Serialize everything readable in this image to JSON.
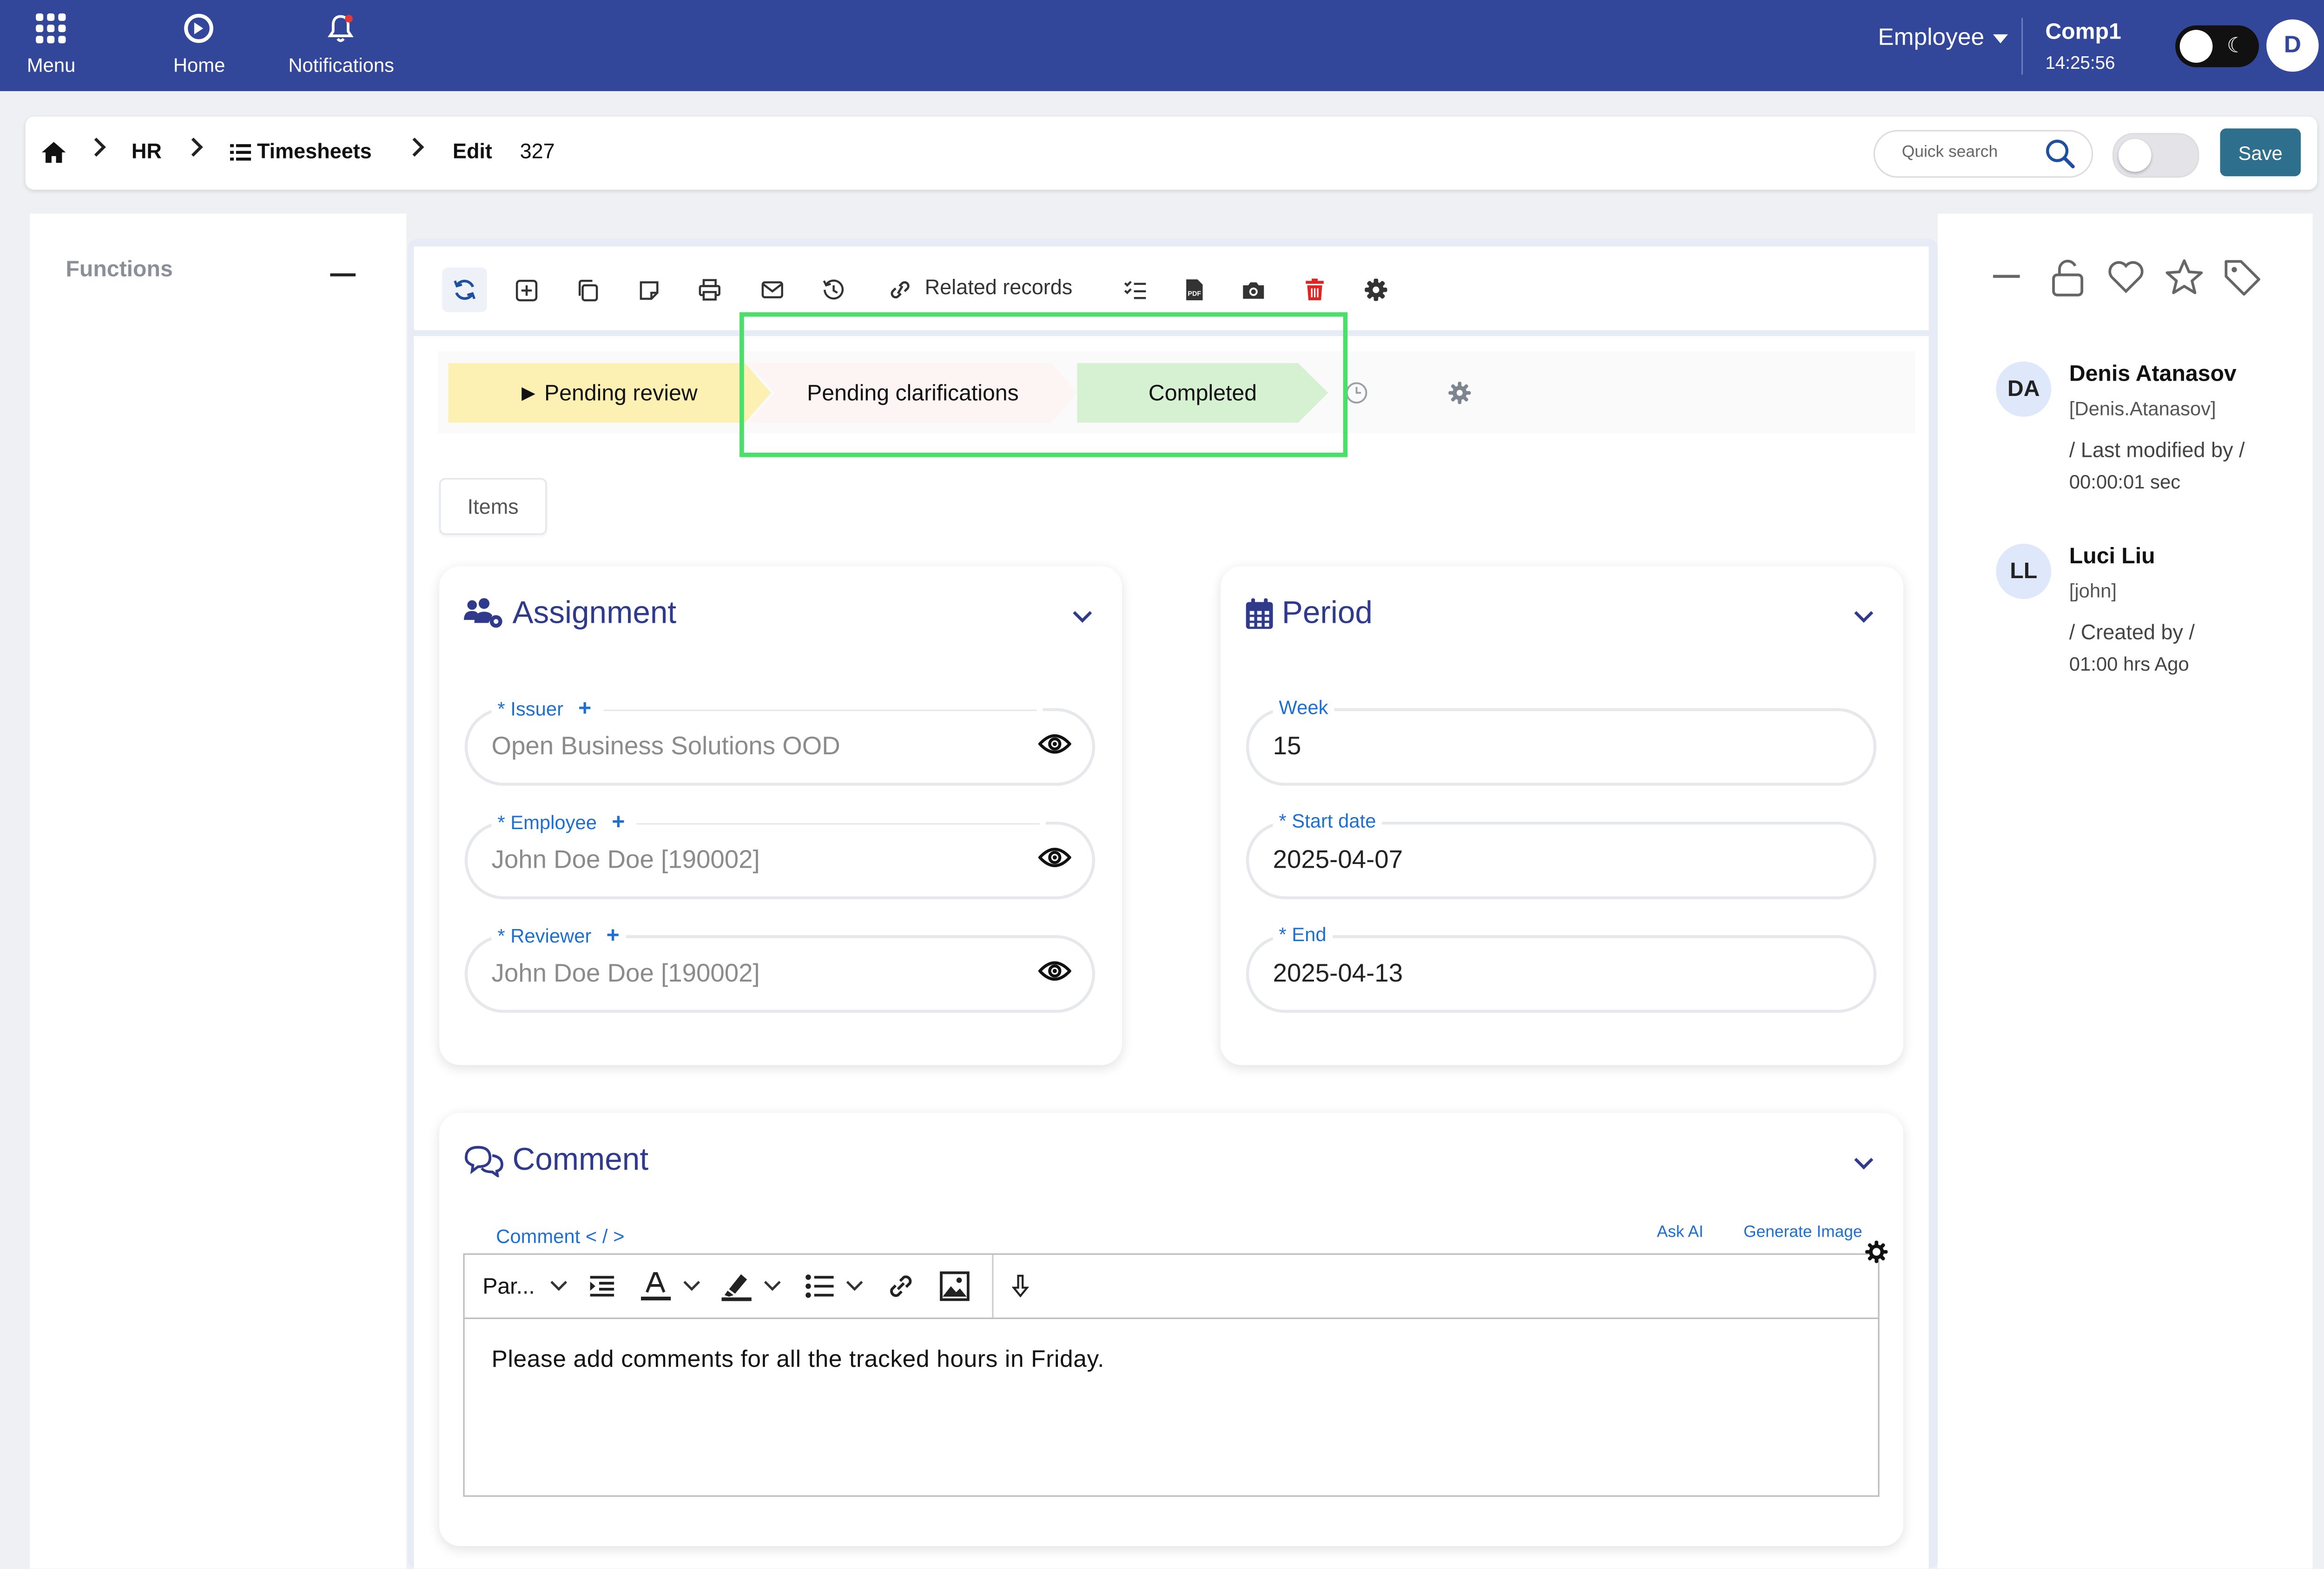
{
  "topbar": {
    "menu_label": "Menu",
    "home_label": "Home",
    "notifications_label": "Notifications",
    "role": "Employee",
    "company": "Comp1",
    "clock": "14:25:56",
    "user_initial": "D"
  },
  "breadcrumb": {
    "hr": "HR",
    "timesheets": "Timesheets",
    "edit": "Edit",
    "record_id": "327"
  },
  "search": {
    "placeholder": "Quick search"
  },
  "actions": {
    "save_label": "Save"
  },
  "left_panel": {
    "title": "Functions"
  },
  "toolbar": {
    "related_records": "Related records"
  },
  "status_flow": [
    "Pending review",
    "Pending clarifications",
    "Completed"
  ],
  "tabs": {
    "items": "Items"
  },
  "assignment": {
    "title": "Assignment",
    "issuer": {
      "label": "* Issuer",
      "value": "Open Business Solutions OOD"
    },
    "employee": {
      "label": "* Employee",
      "value": "John Doe Doe [190002]"
    },
    "reviewer": {
      "label": "* Reviewer",
      "value": "John Doe Doe [190002]"
    }
  },
  "period": {
    "title": "Period",
    "week": {
      "label": "Week",
      "value": "15"
    },
    "start": {
      "label": "* Start date",
      "value": "2025-04-07"
    },
    "end": {
      "label": "* End",
      "value": "2025-04-13"
    }
  },
  "comment": {
    "title": "Comment",
    "label": "Comment < / >",
    "ask_ai": "Ask AI",
    "generate_image": "Generate Image",
    "paragraph": "Par...",
    "text": "Please add comments for all the tracked hours in Friday."
  },
  "people": [
    {
      "initials": "DA",
      "name": "Denis Atanasov",
      "login": "[Denis.Atanasov]",
      "action": "/ Last modified by /",
      "time": "00:00:01 sec"
    },
    {
      "initials": "LL",
      "name": "Luci Liu",
      "login": "[john]",
      "action": "/ Created by /",
      "time": "01:00 hrs Ago"
    }
  ],
  "colors": {
    "topbar": "#33479a",
    "accent_text": "#2f3a8c",
    "link": "#1f6fd1",
    "save": "#2e6f8e",
    "status_pending_review": "#fdf0b3",
    "status_pending_clarifications": "#fdf4f4",
    "status_completed": "#d6f1d2",
    "highlight_box": "#4ade6b",
    "delete_icon": "#e02424"
  }
}
